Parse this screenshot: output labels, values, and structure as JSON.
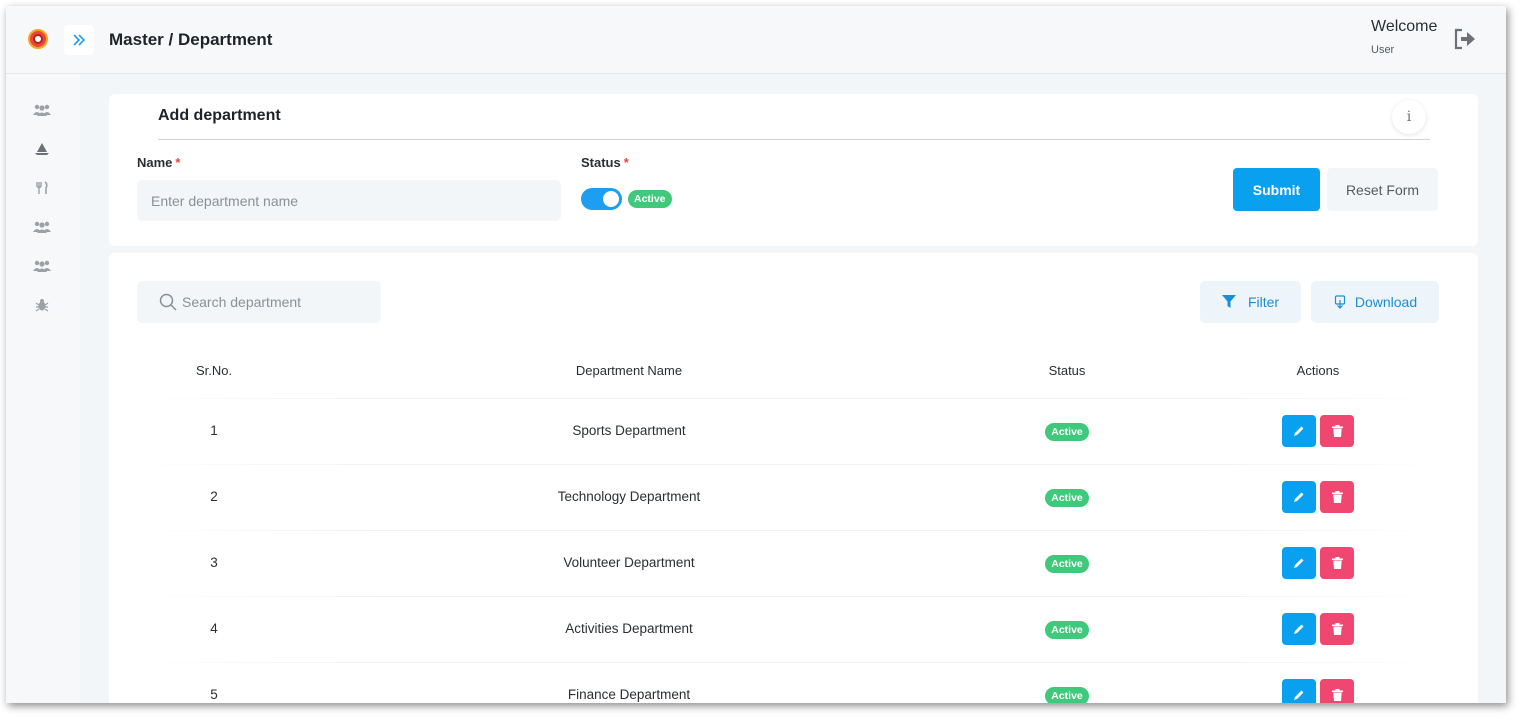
{
  "header": {
    "title": "Master / Department",
    "welcome": "Welcome",
    "user": "User"
  },
  "sidebar": {
    "icons": [
      "users-icon",
      "ship-icon",
      "utensils-icon",
      "users-icon",
      "users-icon",
      "bug-icon"
    ]
  },
  "add_form": {
    "title": "Add department",
    "info": "i",
    "name_label": "Name",
    "name_placeholder": "Enter department name",
    "name_value": "",
    "status_label": "Status",
    "required_mark": "*",
    "status_toggle_on": true,
    "status_text": "Active",
    "submit_label": "Submit",
    "reset_label": "Reset Form"
  },
  "list": {
    "search_placeholder": "Search department",
    "filter_label": "Filter",
    "download_label": "Download",
    "columns": [
      "Sr.No.",
      "Department Name",
      "Status",
      "Actions"
    ],
    "rows": [
      {
        "sr": "1",
        "name": "Sports Department",
        "status": "Active"
      },
      {
        "sr": "2",
        "name": "Technology Department",
        "status": "Active"
      },
      {
        "sr": "3",
        "name": "Volunteer Department",
        "status": "Active"
      },
      {
        "sr": "4",
        "name": "Activities Department",
        "status": "Active"
      },
      {
        "sr": "5",
        "name": "Finance Department",
        "status": "Active"
      }
    ]
  },
  "colors": {
    "primary": "#0aa0f0",
    "danger": "#ef476f",
    "success": "#3ec97b"
  }
}
